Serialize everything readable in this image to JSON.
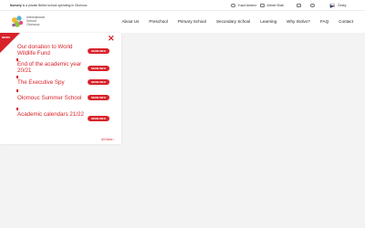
{
  "topbar": {
    "intro_bold": "Nursery",
    "intro_rest": "is a private British school operating in Olomouc",
    "phone": "Yusuf Alvarez",
    "email": "Ahmet Shah",
    "lang": "Česky"
  },
  "header": {
    "logo_lines": [
      "International",
      "School",
      "Olomouc"
    ],
    "nav": [
      "About Us",
      "Preschool",
      "Primary School",
      "Secondary School",
      "Learning",
      "Why ISolvo?",
      "FAQ",
      "Contact"
    ]
  },
  "panel": {
    "corner_label": "NEWS",
    "items": [
      {
        "title": "Our donation to World Wildlife Fund",
        "button": "MORE INFO"
      },
      {
        "title": "End of the academic year 20/21",
        "button": "MORE INFO"
      },
      {
        "title": "The Executive Spy",
        "button": "MORE INFO"
      },
      {
        "title": "Olomouc Summer School",
        "button": "MORE INFO"
      },
      {
        "title": "Academic calendars 21/22",
        "button": "MORE INFO"
      }
    ],
    "more_label": "All News  ›"
  },
  "colors": {
    "accent": "#d8232a",
    "background": "#f3f3f3"
  }
}
